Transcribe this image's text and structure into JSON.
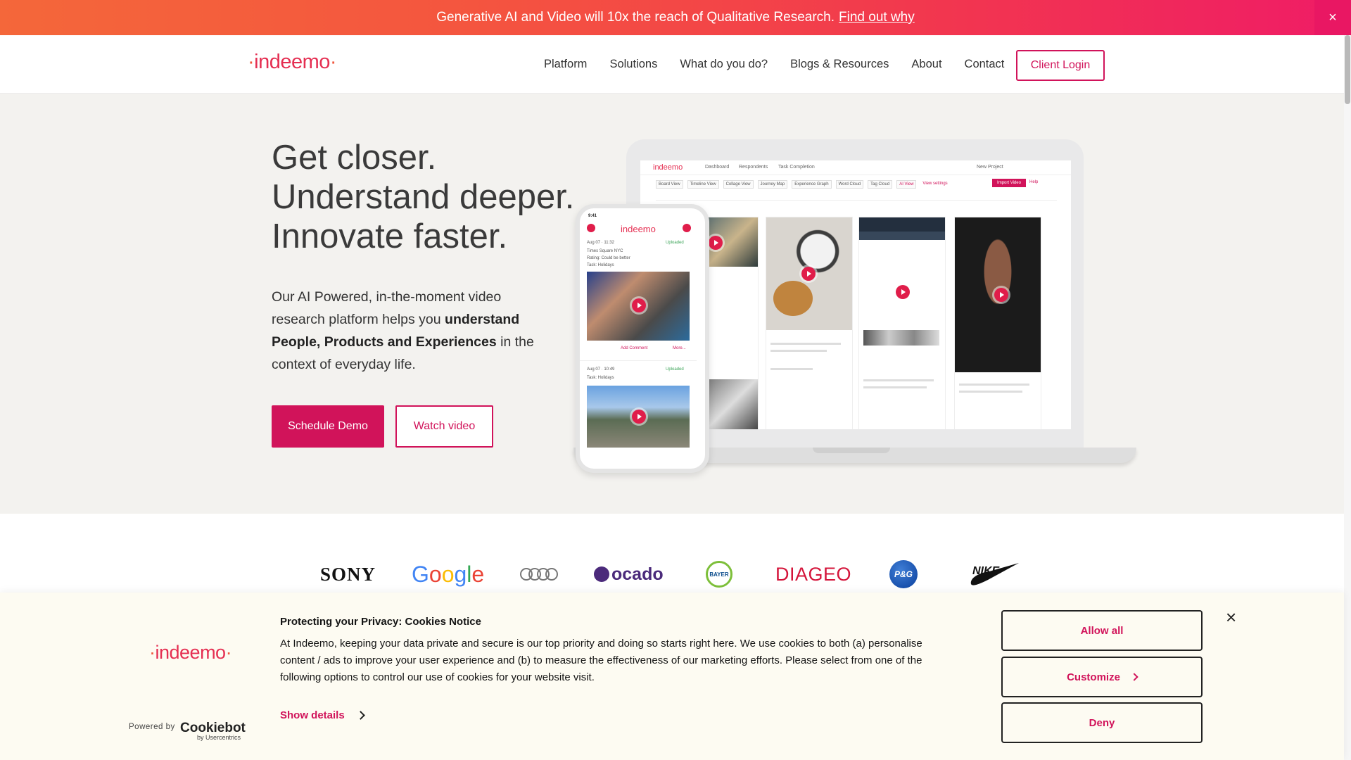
{
  "announcement": {
    "text": "Generative AI and Video will 10x the reach of Qualitative Research.",
    "link": "Find out why",
    "close_glyph": "×"
  },
  "header": {
    "logo_text": "indeemo",
    "nav": [
      "Platform",
      "Solutions",
      "What do you do?",
      "Blogs & Resources",
      "About",
      "Contact"
    ],
    "client_login": "Client Login"
  },
  "hero": {
    "title_lines": [
      "Get closer.",
      "Understand deeper.",
      "Innovate faster."
    ],
    "desc_part1": "Our AI Powered, in-the-moment video research platform helps you ",
    "desc_bold": "understand People, Products and Experiences",
    "desc_part2": " in the context of everyday life.",
    "schedule_demo": "Schedule Demo",
    "watch_video": "Watch video"
  },
  "mockup": {
    "app_logo": "indeemo",
    "top_items": [
      "Dashboard",
      "Respondents",
      "Task Completion",
      "New Project"
    ],
    "tabs": [
      "Board View",
      "Timeline View",
      "Collage View",
      "Journey Map",
      "Experience Graph",
      "Word Cloud",
      "Tag Cloud",
      "AI View",
      "View settings"
    ],
    "import_video": "Import Video",
    "help": "Help",
    "phone_time": "9:41",
    "phone_entries": [
      {
        "date": "Aug 07 · 11:32",
        "location": "Times Square NYC",
        "rating": "Rating:  Could be better",
        "task": "Task:  Holidays",
        "uploaded": "Uploaded"
      },
      {
        "date": "Aug 07 · 10:49",
        "task": "Task:  Holidays",
        "uploaded": "Uploaded"
      }
    ],
    "add_comment": "Add Comment",
    "more": "More..."
  },
  "brands": [
    "SONY",
    "Google",
    "Audi",
    "ocado",
    "BAYER",
    "DIAGEO",
    "P&G",
    "NIKE"
  ],
  "cookie": {
    "logo_text": "indeemo",
    "title": "Protecting your Privacy: Cookies Notice",
    "text": "At Indeemo, keeping your data private and secure is our top priority and doing so starts right here.  We use cookies to both (a) personalise content / ads to improve your user experience and (b) to measure the effectiveness of our marketing efforts. Please select from one of the following options to control our use of cookies for your website visit.",
    "show_details": "Show details",
    "powered_by": "Powered by",
    "cookiebot": "Cookiebot",
    "cookiebot_sub": "by Usercentrics",
    "allow_all": "Allow all",
    "customize": "Customize",
    "deny": "Deny",
    "close_glyph": "×"
  },
  "colors": {
    "accent": "#d1135a",
    "logo": "#e52f52",
    "banner_bg": "#fdfbf2",
    "hero_bg": "#f3f2ef"
  }
}
